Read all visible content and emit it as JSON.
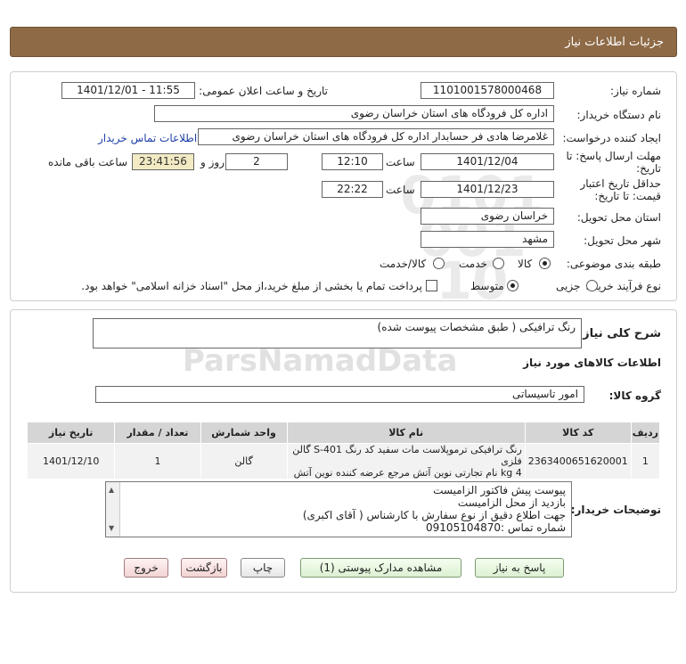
{
  "header": {
    "title": "جزئیات اطلاعات نیاز"
  },
  "form": {
    "need_number_label": "شماره نیاز:",
    "need_number": "1101001578000468",
    "announce_label": "تاریخ و ساعت اعلان عمومی:",
    "announce_value": "1401/12/01 - 11:55",
    "buyer_org_label": "نام دستگاه خریدار:",
    "buyer_org": "اداره کل فرودگاه های استان خراسان رضوی",
    "creator_label": "ایجاد کننده درخواست:",
    "creator": "غلامرضا هادی فر حسابدار اداره کل فرودگاه های استان خراسان رضوی",
    "contact_link": "اطلاعات تماس خریدار",
    "reply_deadline_label_1": "مهلت ارسال پاسخ: تا",
    "reply_deadline_label_2": "تاریخ:",
    "reply_date": "1401/12/04",
    "time_label": "ساعت",
    "reply_time": "12:10",
    "days_value": "2",
    "days_label": "روز و",
    "remaining_time": "23:41:56",
    "remaining_label": "ساعت باقی مانده",
    "validity_label_1": "حداقل تاریخ اعتبار",
    "validity_label_2": "قیمت: تا تاریخ:",
    "validity_date": "1401/12/23",
    "validity_time_label": "ساعت",
    "validity_time": "22:22",
    "province_label": "استان محل تحویل:",
    "province": "خراسان رضوی",
    "city_label": "شهر محل تحویل:",
    "city": "مشهد",
    "category_label": "طبقه بندی موضوعی:",
    "category_options": [
      "کالا",
      "خدمت",
      "کالا/خدمت"
    ],
    "category_selected": "کالا",
    "process_label": "نوع فرآیند خرید :",
    "process_options": [
      "جزیی",
      "متوسط"
    ],
    "process_selected": "متوسط",
    "payment_note": "پرداخت تمام یا بخشی از مبلغ خرید،از محل \"اسناد خزانه اسلامی\" خواهد بود."
  },
  "details": {
    "summary_label": "شرح کلی نیاز:",
    "summary": "رنگ ترافیکی ( طبق مشخصات پیوست شده)",
    "goods_section_title": "اطلاعات کالاهای مورد نیاز",
    "goods_group_label": "گروه کالا:",
    "goods_group": "امور تاسیساتی",
    "table": {
      "headers": [
        "ردیف",
        "کد کالا",
        "نام کالا",
        "واحد شمارش",
        "تعداد / مقدار",
        "تاریخ نیاز"
      ],
      "rows": [
        {
          "row": "1",
          "code": "2363400651620001",
          "name_line1": "رنگ ترافیکی ترموپلاست مات سفید کد رنگ S-401 گالن فلزی",
          "name_line2": "4 kg نام تجارتی نوین آتش مرجع عرضه کننده نوین آتش",
          "unit": "گالن",
          "qty": "1",
          "date": "1401/12/10"
        }
      ]
    },
    "buyer_notes_label": "توضیحات خریدار:",
    "buyer_notes": [
      "پیوست پیش فاکتور الزامیست",
      "بازدید از محل الزامیست",
      "جهت اطلاع دقیق از نوع سفارش با کارشناس   ( آقای اکبری)",
      "شماره تماس :09105104870"
    ]
  },
  "buttons": {
    "reply": "پاسخ به نیاز",
    "view_docs": "مشاهده مدارک پیوستی (1)",
    "print": "چاپ",
    "back": "بازگشت",
    "exit": "خروج"
  },
  "colors": {
    "header_bg": "#8e6a46",
    "link": "#1d3fa8",
    "remaining_bg": "#f2eac3"
  }
}
